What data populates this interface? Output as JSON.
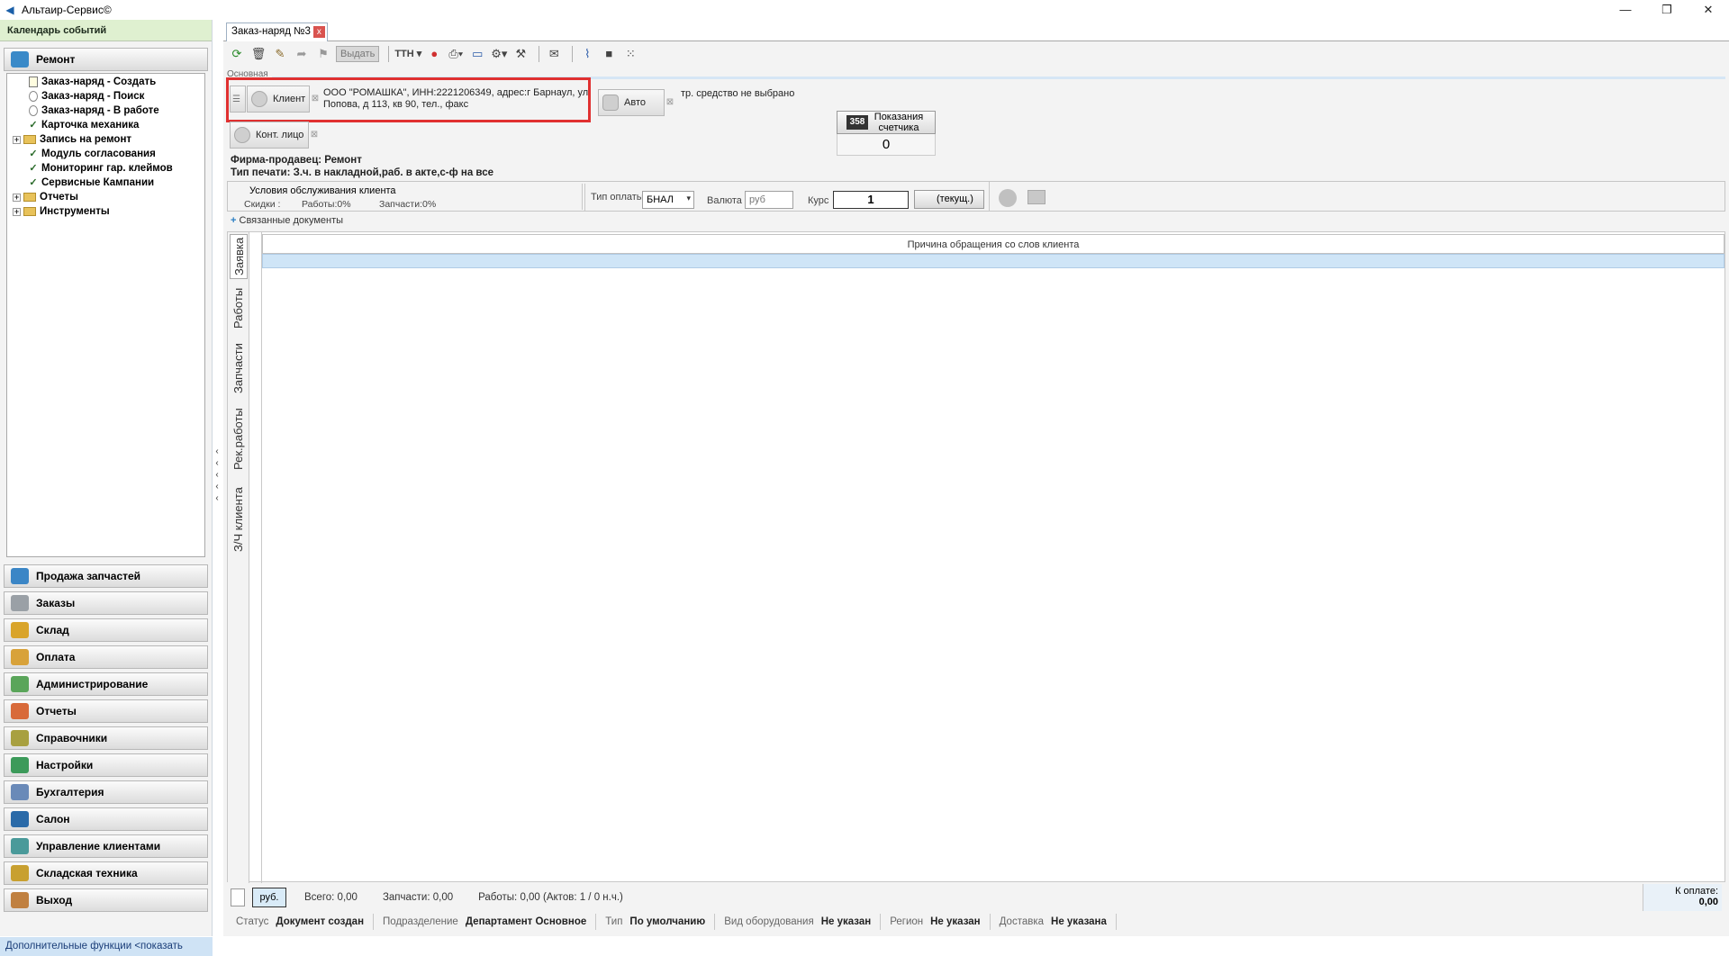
{
  "window": {
    "title": "Альтаир-Сервис©",
    "minimize": "—",
    "restore": "❐",
    "close": "✕"
  },
  "sidebar": {
    "calendar": "Календарь событий",
    "repair": "Ремонт",
    "tree": [
      {
        "label": "Заказ-наряд - Создать",
        "kind": "doc"
      },
      {
        "label": "Заказ-наряд - Поиск",
        "kind": "circle"
      },
      {
        "label": "Заказ-наряд - В работе",
        "kind": "circle"
      },
      {
        "label": "Карточка механика",
        "kind": "check"
      },
      {
        "label": "Запись на ремонт",
        "kind": "folder"
      },
      {
        "label": "Модуль согласования",
        "kind": "check"
      },
      {
        "label": "Мониторинг гар. клеймов",
        "kind": "check"
      },
      {
        "label": "Сервисные Кампании",
        "kind": "check"
      },
      {
        "label": "Отчеты",
        "kind": "folder"
      },
      {
        "label": "Инструменты",
        "kind": "folder"
      }
    ],
    "sections": [
      {
        "label": "Продажа запчастей",
        "color": "#3b86c6"
      },
      {
        "label": "Заказы",
        "color": "#9aa0a6"
      },
      {
        "label": "Склад",
        "color": "#d9a42a"
      },
      {
        "label": "Оплата",
        "color": "#d8a23a"
      },
      {
        "label": "Администрирование",
        "color": "#5aa55a"
      },
      {
        "label": "Отчеты",
        "color": "#d86a3a"
      },
      {
        "label": "Справочники",
        "color": "#a8a040"
      },
      {
        "label": "Настройки",
        "color": "#3c9a5a"
      },
      {
        "label": "Бухгалтерия",
        "color": "#6a8ab8"
      },
      {
        "label": "Салон",
        "color": "#2a6aa8"
      },
      {
        "label": "Управление клиентами",
        "color": "#4a9a9a"
      },
      {
        "label": "Складская техника",
        "color": "#c8a030"
      },
      {
        "label": "Выход",
        "color": "#c08040"
      }
    ],
    "more": "Дополнительные функции <показать"
  },
  "tab": {
    "label": "Заказ-наряд №3",
    "close": "x"
  },
  "toolbar": {
    "issue": "Выдать",
    "ttn": "ТТН"
  },
  "form": {
    "section": "Основная",
    "client_btn": "Клиент",
    "client_text": "ООО \"РОМАШКА\", ИНН:2221206349, адрес:г Барнаул, ул Попова, д 113, кв 90, тел., факс",
    "auto_btn": "Авто",
    "vehicle_text": "тр. средство не выбрано",
    "contact_btn": "Конт. лицо",
    "counter_label": "Показания счетчика",
    "counter_value": "0",
    "counter_icon": "358",
    "seller": "Фирма-продавец: Ремонт",
    "print_type": "Тип печати: З.ч. в накладной,раб. в акте,с-ф на все",
    "conditions_title": "Условия обслуживания клиента",
    "discounts": "Скидки :",
    "works_discount": "Работы:0%",
    "parts_discount": "Запчасти:0%",
    "pay_type_label": "Тип оплаты",
    "pay_type_value": "БНАЛ",
    "currency_label": "Валюта",
    "currency_value": "руб",
    "rate_label": "Курс",
    "rate_value": "1",
    "current_btn": "(текущ.)",
    "related_docs": "Связанные документы"
  },
  "vtabs": [
    "Заявка",
    "Работы",
    "Запчасти",
    "Рек.работы",
    "З/Ч клиента"
  ],
  "grid": {
    "header": "Причина обращения со слов клиента"
  },
  "footer": {
    "currency": "руб.",
    "total": "Всего: 0,00",
    "parts": "Запчасти: 0,00",
    "works": "Работы: 0,00 (Актов: 1 / 0 н.ч.)",
    "to_pay_label": "К оплате:",
    "to_pay_value": "0,00"
  },
  "status": [
    {
      "k": "Статус",
      "v": "Документ создан"
    },
    {
      "k": "Подразделение",
      "v": "Департамент Основное"
    },
    {
      "k": "Тип",
      "v": "По умолчанию"
    },
    {
      "k": "Вид оборудования",
      "v": "Не указан"
    },
    {
      "k": "Регион",
      "v": "Не указан"
    },
    {
      "k": "Доставка",
      "v": "Не указана"
    }
  ]
}
